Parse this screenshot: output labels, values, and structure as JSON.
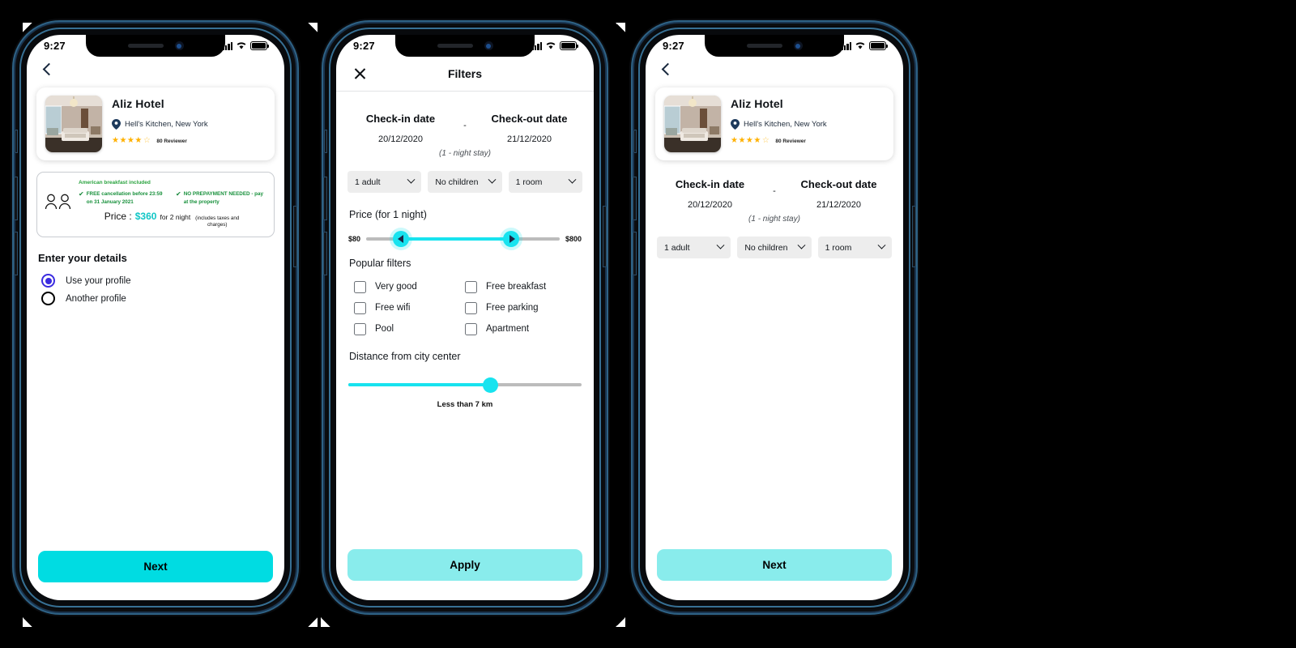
{
  "status_bar": {
    "time": "9:27",
    "signal_icon": "cellular-bars-icon",
    "wifi_icon": "wifi-icon",
    "battery_icon": "battery-full-icon"
  },
  "colors": {
    "accent_cyan": "#00e0e6",
    "accent_cyan_light": "#89ecec",
    "radio_blue": "#3b2ce0",
    "star_gold": "#ffb100",
    "green": "#17903b",
    "price_teal": "#11c6c6"
  },
  "hotel": {
    "name": "Aliz Hotel",
    "location": "Hell's Kitchen, New York",
    "location_icon": "map-pin-icon",
    "rating_filled": 4,
    "rating_total": 5,
    "reviewers": "80 Reviewer",
    "thumb_alt": "hotel-room-photo"
  },
  "screen1": {
    "back_icon": "back-chevron-icon",
    "guests_icon": "two-people-icon",
    "deal": {
      "breakfast": "American breakfast included",
      "cancellation": "FREE cancellation before 23:59 on 31 January 2021",
      "prepayment": "NO PREPAYMENT NEEDED - pay at the property",
      "check_icon": "check-icon",
      "price_label": "Price :",
      "price_amount": "$360",
      "price_for": "for 2 night",
      "price_note": "(includes taxes and charges)"
    },
    "details_title": "Enter your details",
    "radio_options": [
      {
        "label": "Use your profile",
        "selected": true
      },
      {
        "label": "Another profile",
        "selected": false
      }
    ],
    "cta_label": "Next"
  },
  "screen2": {
    "close_icon": "close-icon",
    "title": "Filters",
    "checkin_label": "Check-in date",
    "checkin_value": "20/12/2020",
    "separator": "-",
    "checkout_label": "Check-out date",
    "checkout_value": "21/12/2020",
    "nights": "(1 - night stay)",
    "selects": [
      {
        "value": "1 adult",
        "icon": "chevron-down-icon"
      },
      {
        "value": "No children",
        "icon": "chevron-down-icon"
      },
      {
        "value": "1 room",
        "icon": "chevron-down-icon"
      }
    ],
    "price_title": "Price (for 1 night)",
    "price_min": "$80",
    "price_max": "$800",
    "price_min_pct": 18,
    "price_max_pct": 75,
    "popular_title": "Popular filters",
    "popular_filters": [
      {
        "label": "Very good",
        "checked": false
      },
      {
        "label": "Free breakfast",
        "checked": false
      },
      {
        "label": "Free wifi",
        "checked": false
      },
      {
        "label": "Free parking",
        "checked": false
      },
      {
        "label": "Pool",
        "checked": false
      },
      {
        "label": "Apartment",
        "checked": false
      }
    ],
    "distance_title": "Distance from city center",
    "distance_pct": 61,
    "distance_caption": "Less than 7 km",
    "cta_label": "Apply"
  },
  "screen3": {
    "back_icon": "back-chevron-icon",
    "checkin_label": "Check-in date",
    "checkin_value": "20/12/2020",
    "separator": "-",
    "checkout_label": "Check-out date",
    "checkout_value": "21/12/2020",
    "nights": "(1 - night stay)",
    "selects": [
      {
        "value": "1 adult",
        "icon": "chevron-down-icon"
      },
      {
        "value": "No children",
        "icon": "chevron-down-icon"
      },
      {
        "value": "1 room",
        "icon": "chevron-down-icon"
      }
    ],
    "cta_label": "Next"
  }
}
